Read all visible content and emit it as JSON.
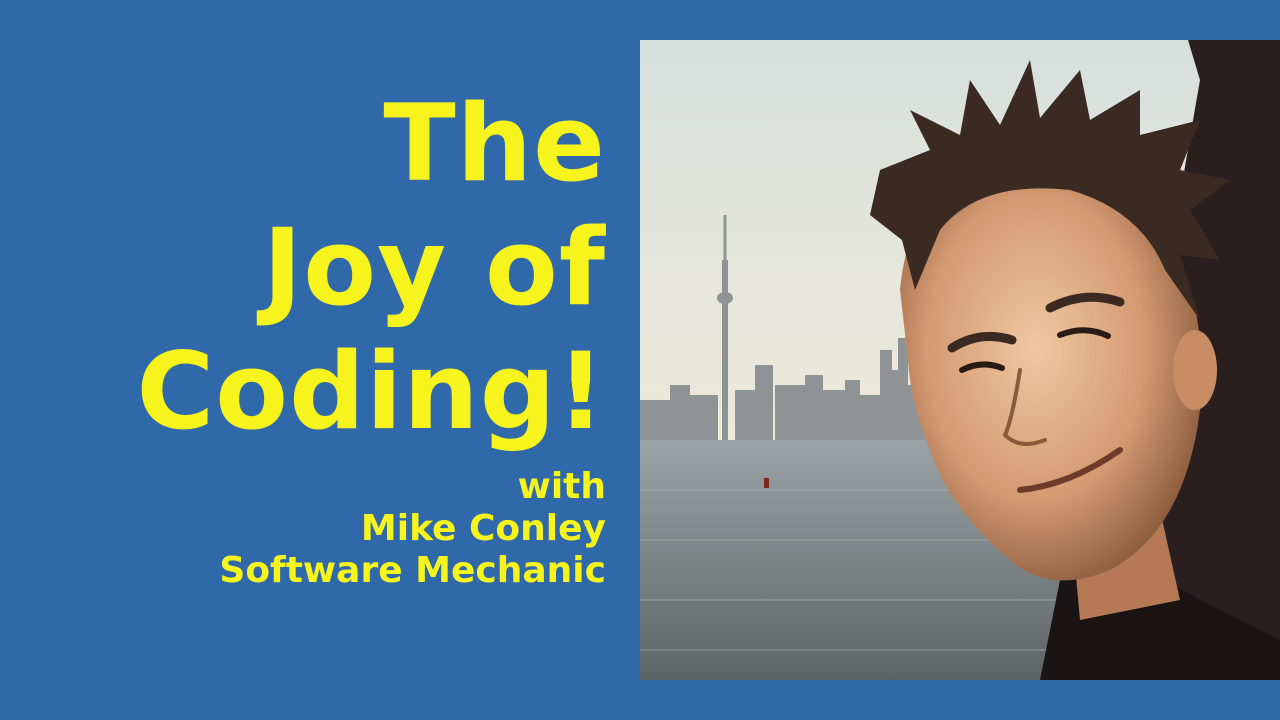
{
  "title": {
    "lines": [
      "The",
      "Joy of",
      "Coding!"
    ]
  },
  "byline": {
    "lines": [
      "with",
      "Mike Conley",
      "Software Mechanic"
    ]
  },
  "photo": {
    "subject": "selfie-with-city-skyline"
  },
  "colors": {
    "background": "#2f69a9",
    "text": "#f7f31c"
  }
}
